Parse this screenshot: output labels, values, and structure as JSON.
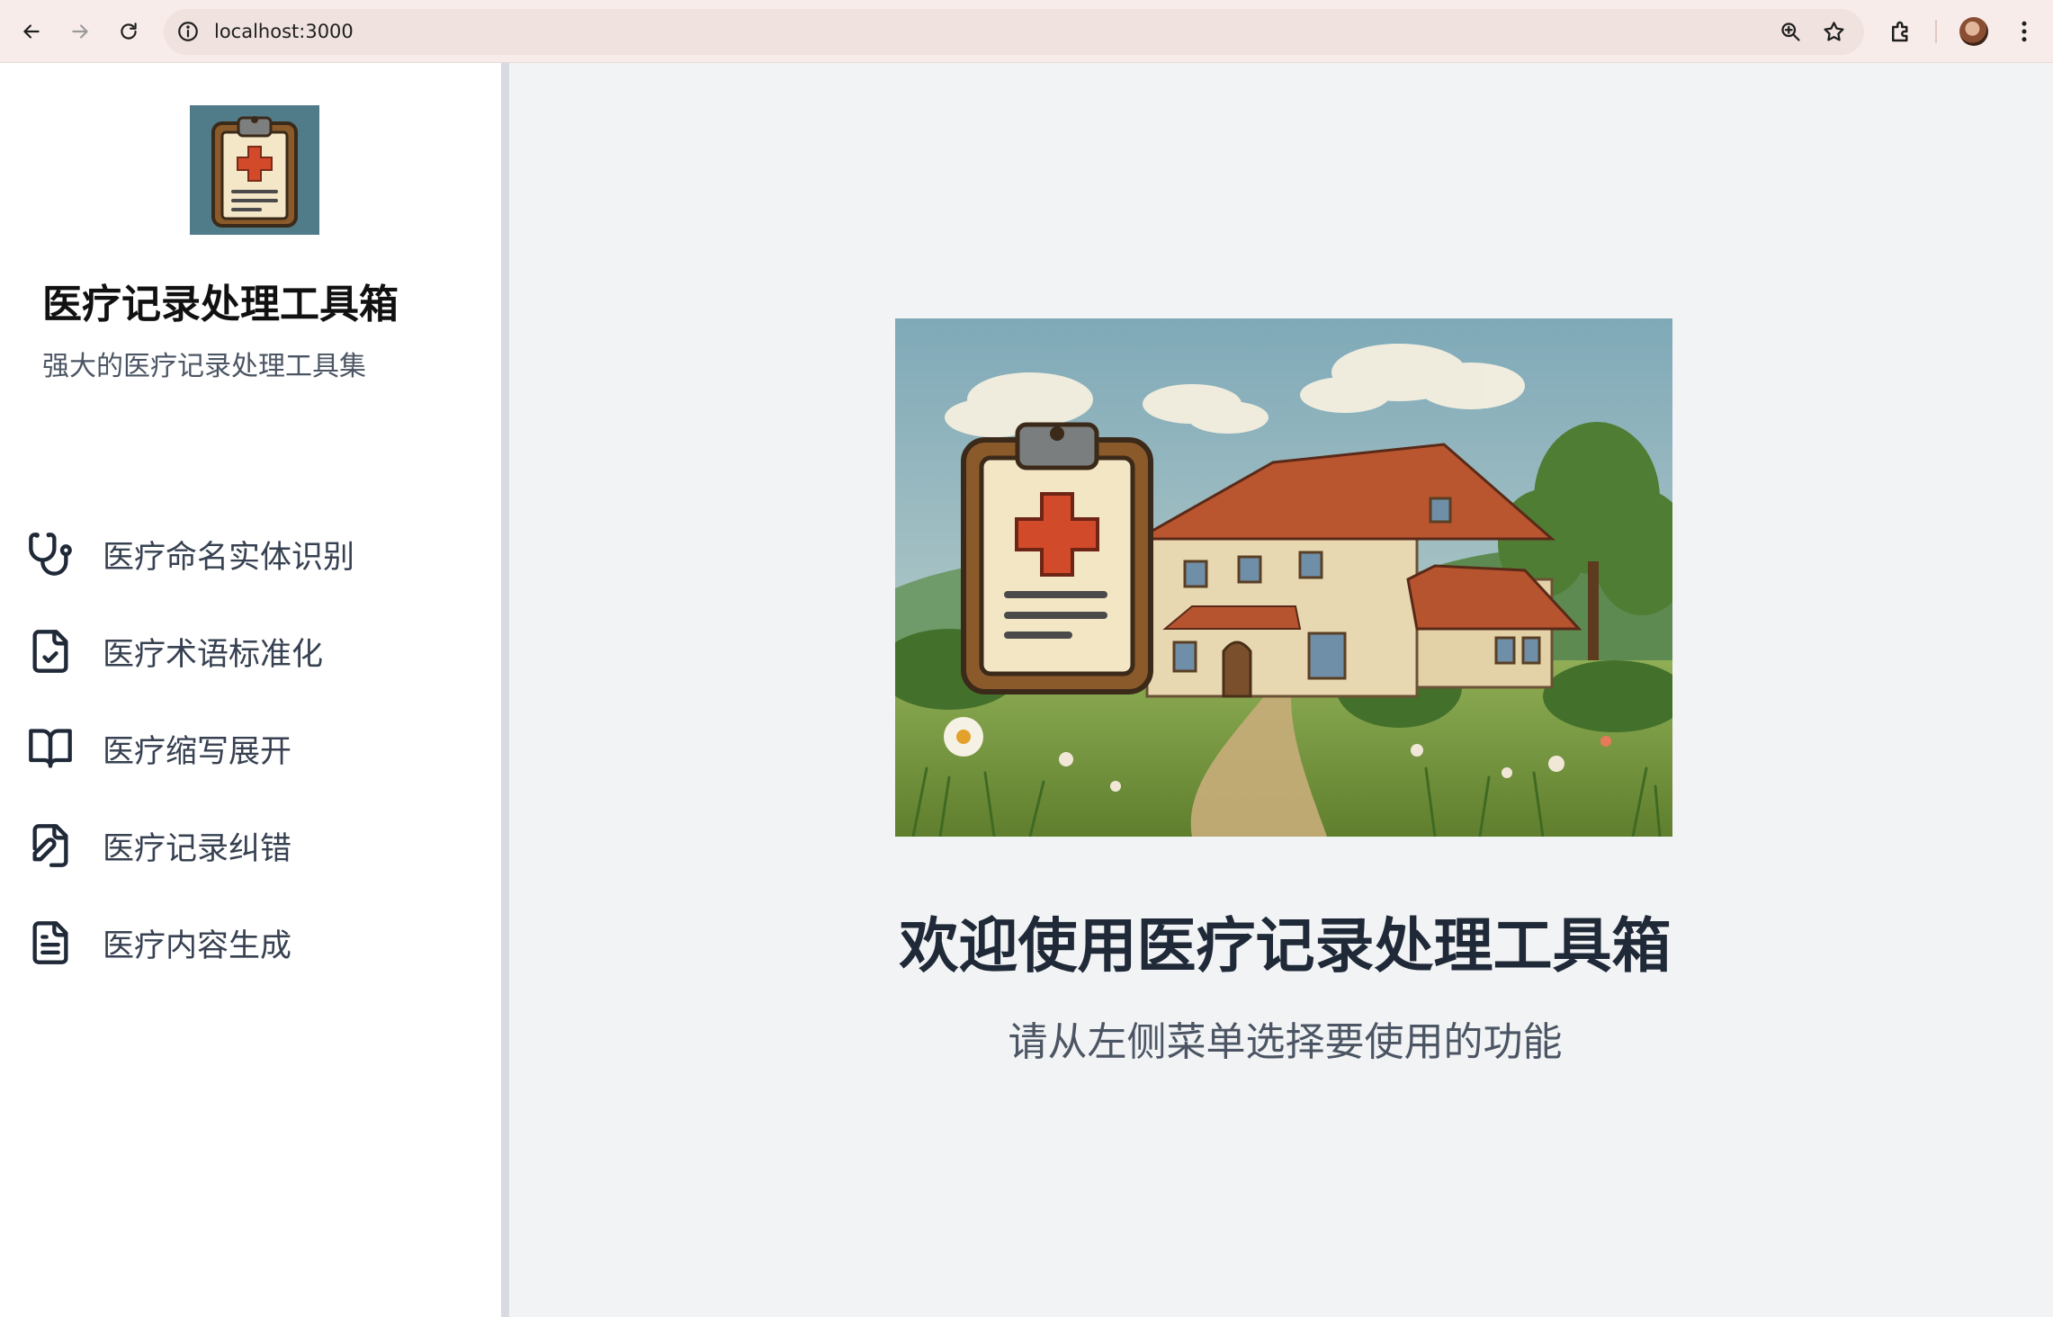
{
  "browser": {
    "url": "localhost:3000"
  },
  "sidebar": {
    "title": "医疗记录处理工具箱",
    "subtitle": "强大的医疗记录处理工具集",
    "items": [
      {
        "label": "医疗命名实体识别",
        "icon": "stethoscope-icon"
      },
      {
        "label": "医疗术语标准化",
        "icon": "file-check-icon"
      },
      {
        "label": "医疗缩写展开",
        "icon": "book-open-icon"
      },
      {
        "label": "医疗记录纠错",
        "icon": "file-pen-icon"
      },
      {
        "label": "医疗内容生成",
        "icon": "file-text-icon"
      }
    ]
  },
  "main": {
    "welcome_title": "欢迎使用医疗记录处理工具箱",
    "welcome_hint": "请从左侧菜单选择要使用的功能"
  },
  "colors": {
    "sidebar_bg": "#ffffff",
    "main_bg": "#f2f3f5",
    "title_text": "#1f2937",
    "muted_text": "#4b5563",
    "icon_stroke": "#1f2937",
    "chrome_bg": "#f8ecea"
  }
}
